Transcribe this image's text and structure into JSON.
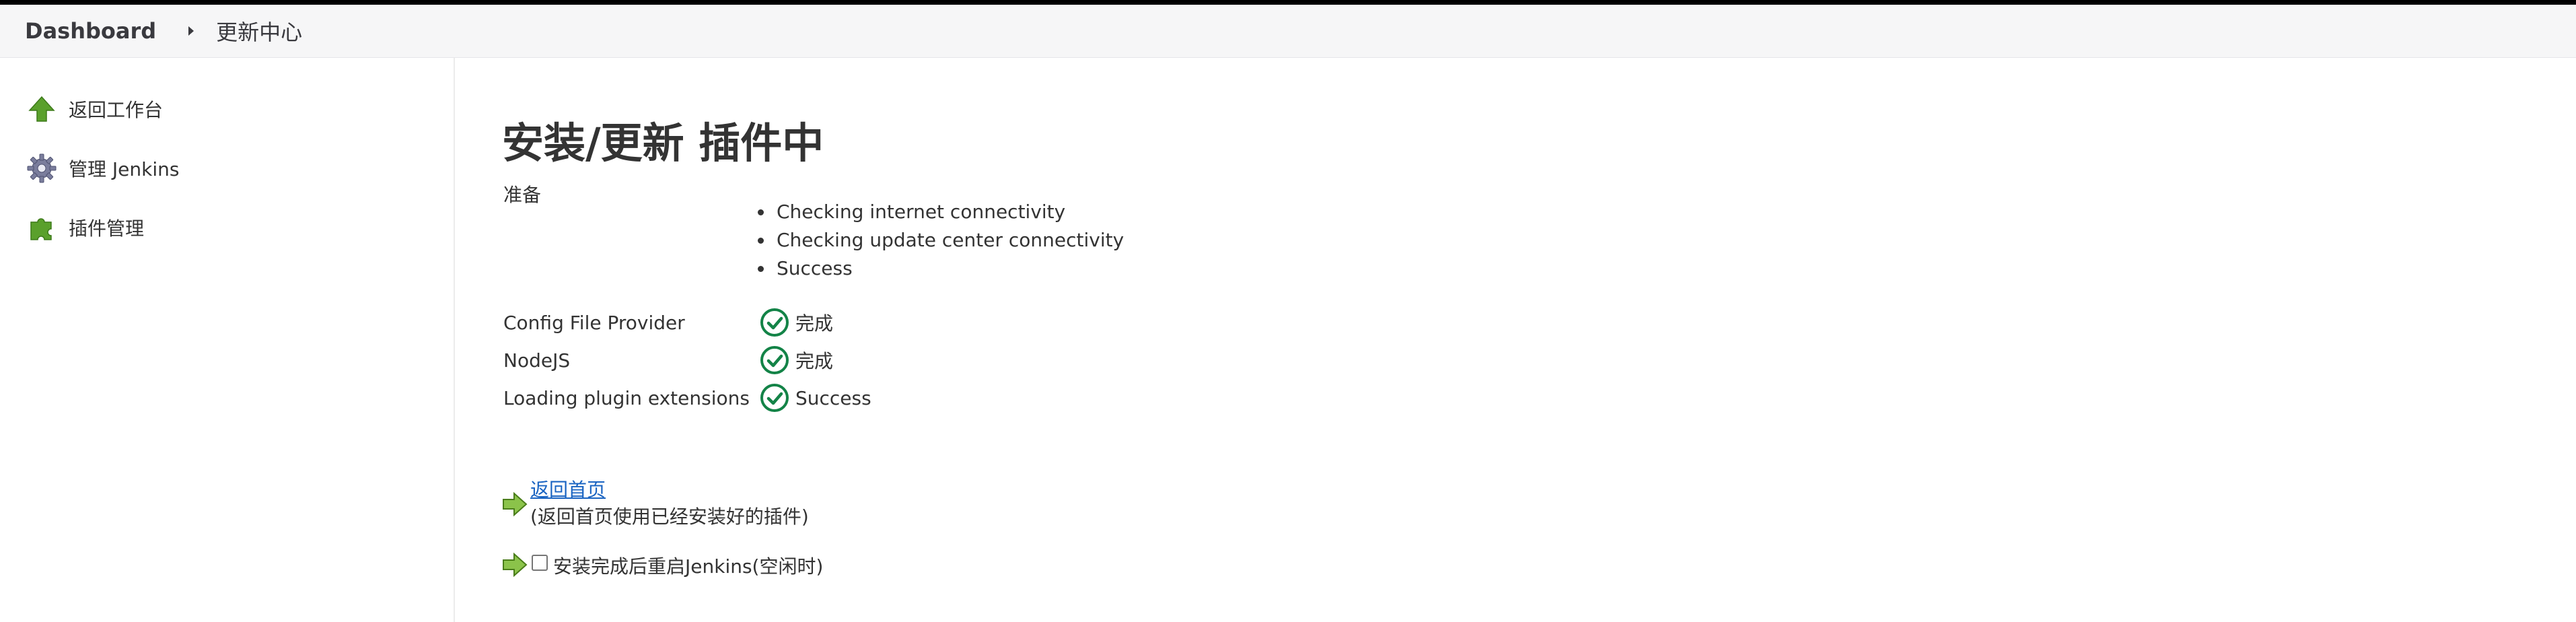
{
  "breadcrumb": {
    "items": [
      "Dashboard",
      "更新中心"
    ]
  },
  "sidebar": {
    "items": [
      {
        "label": "返回工作台",
        "icon": "up-arrow-icon"
      },
      {
        "label": "管理 Jenkins",
        "icon": "gear-icon"
      },
      {
        "label": "插件管理",
        "icon": "puzzle-icon"
      }
    ]
  },
  "main": {
    "title": "安装/更新 插件中",
    "preparation": {
      "label": "准备",
      "steps": [
        "Checking internet connectivity",
        "Checking update center connectivity",
        "Success"
      ]
    },
    "plugins": [
      {
        "name": "Config File Provider",
        "status": "完成"
      },
      {
        "name": "NodeJS",
        "status": "完成"
      },
      {
        "name": "Loading plugin extensions",
        "status": "Success"
      }
    ],
    "actions": {
      "home_link": "返回首页",
      "home_desc": "(返回首页使用已经安装好的插件)",
      "restart_label": "安装完成后重启Jenkins(空闲时)",
      "restart_checked": false
    }
  },
  "colors": {
    "success_green": "#138347",
    "icon_green": "#5aa02c",
    "link_blue": "#1a64c2"
  }
}
